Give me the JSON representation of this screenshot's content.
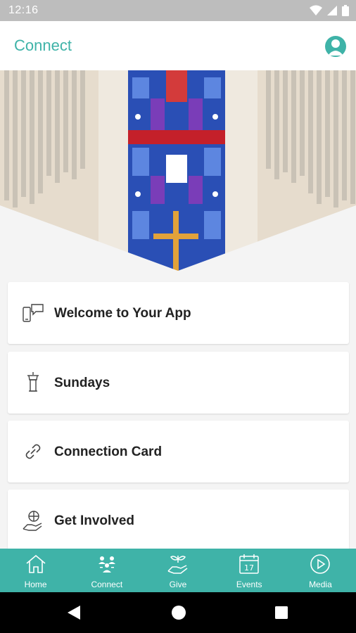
{
  "status_bar": {
    "time": "12:16"
  },
  "app_bar": {
    "title": "Connect"
  },
  "cards": [
    {
      "label": "Welcome to Your App",
      "icon": "chat-devices-icon"
    },
    {
      "label": "Sundays",
      "icon": "pulpit-icon"
    },
    {
      "label": "Connection Card",
      "icon": "link-icon"
    },
    {
      "label": "Get Involved",
      "icon": "globe-hand-icon"
    }
  ],
  "bottom_nav": [
    {
      "label": "Home",
      "icon": "home-icon"
    },
    {
      "label": "Connect",
      "icon": "people-icon"
    },
    {
      "label": "Give",
      "icon": "give-hand-icon"
    },
    {
      "label": "Events",
      "icon": "calendar-icon",
      "date": "17"
    },
    {
      "label": "Media",
      "icon": "play-icon"
    }
  ],
  "colors": {
    "accent": "#3fb3a8",
    "status_bar": "#bdbdbd",
    "background": "#f4f4f4"
  }
}
